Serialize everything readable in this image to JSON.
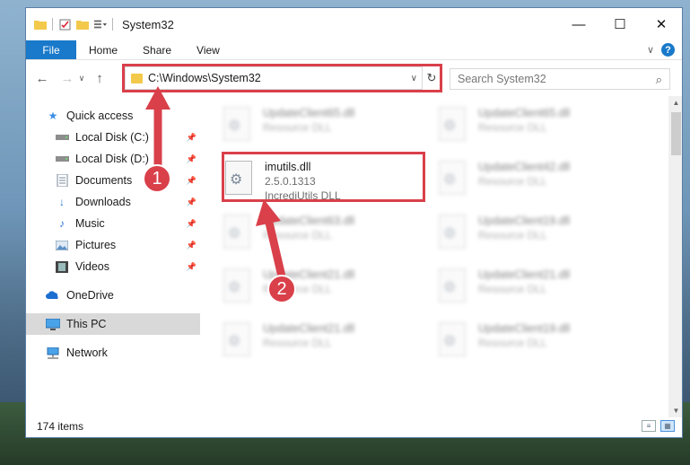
{
  "window": {
    "title": "System32",
    "minimize": "—",
    "maximize": "☐",
    "close": "✕"
  },
  "ribbon": {
    "file": "File",
    "tabs": [
      "Home",
      "Share",
      "View"
    ],
    "expand": "∨",
    "help": "?"
  },
  "nav": {
    "back": "←",
    "forward": "→",
    "recent": "∨",
    "up": "↑",
    "address": "C:\\Windows\\System32",
    "address_dropdown": "∨",
    "refresh": "↻",
    "search_placeholder": "Search System32",
    "search_icon": "⌕"
  },
  "sidebar": {
    "quick_access": "Quick access",
    "items": [
      {
        "label": "Local Disk (C:)",
        "icon": "drive-icon",
        "pinned": true
      },
      {
        "label": "Local Disk (D:)",
        "icon": "drive-icon",
        "pinned": true
      },
      {
        "label": "Documents",
        "icon": "documents-icon",
        "pinned": true
      },
      {
        "label": "Downloads",
        "icon": "downloads-icon",
        "pinned": true
      },
      {
        "label": "Music",
        "icon": "music-icon",
        "pinned": true
      },
      {
        "label": "Pictures",
        "icon": "pictures-icon",
        "pinned": true
      },
      {
        "label": "Videos",
        "icon": "videos-icon",
        "pinned": true
      }
    ],
    "onedrive": "OneDrive",
    "this_pc": "This PC",
    "network": "Network"
  },
  "files": {
    "highlighted": {
      "name": "imutils.dll",
      "version": "2.5.0.1313",
      "description": "IncrediUtils DLL"
    },
    "column1": [
      {
        "name": "UpdateClient65.dll",
        "type": "Resource DLL"
      },
      {
        "name": "UpdateClient63.dll",
        "type": "Resource DLL"
      },
      {
        "name": "UpdateClient21.dll",
        "type": "Resource DLL"
      },
      {
        "name": "UpdateClient21.dll",
        "type": "Resource DLL"
      }
    ],
    "column2": [
      {
        "name": "UpdateClient65.dll",
        "type": "Resource DLL"
      },
      {
        "name": "UpdateClient42.dll",
        "type": "Resource DLL"
      },
      {
        "name": "UpdateClient19.dll",
        "type": "Resource DLL"
      },
      {
        "name": "UpdateClient21.dll",
        "type": "Resource DLL"
      },
      {
        "name": "UpdateClient19.dll",
        "type": "Resource DLL"
      }
    ]
  },
  "status": {
    "items_count": "174 items"
  },
  "annotations": {
    "step1": "1",
    "step2": "2"
  },
  "colors": {
    "accent": "#1979ca",
    "highlight_red": "#d9404a",
    "folder": "#f3c94b"
  }
}
